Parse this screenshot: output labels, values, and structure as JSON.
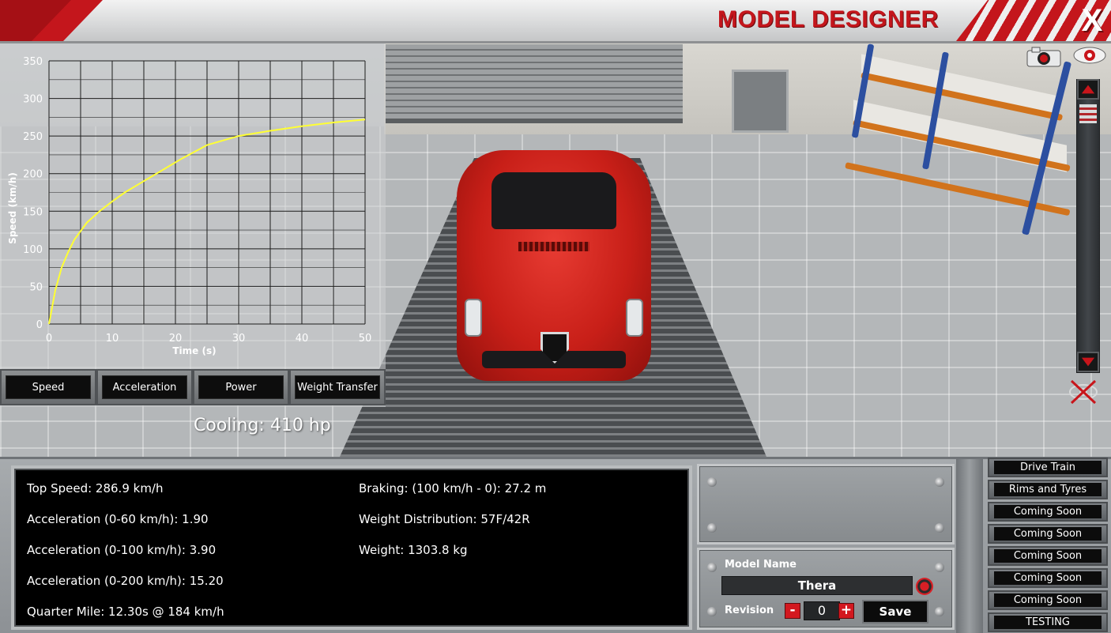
{
  "window": {
    "title": "MODEL DESIGNER",
    "close_label": "X"
  },
  "chart_data": {
    "type": "line",
    "title": "",
    "xlabel": "Time (s)",
    "ylabel": "Speed (km/h)",
    "xlim": [
      0,
      50
    ],
    "ylim": [
      0,
      350
    ],
    "x_ticks": [
      0,
      10,
      20,
      30,
      40,
      50
    ],
    "y_ticks": [
      0,
      50,
      100,
      150,
      200,
      250,
      300,
      350
    ],
    "grid": true,
    "line_color": "#ffff33",
    "series": [
      {
        "x": [
          0,
          1,
          2,
          3,
          4,
          6,
          8,
          10,
          12,
          15,
          18,
          21,
          25,
          30,
          35,
          40,
          45,
          50
        ],
        "y": [
          0,
          45,
          75,
          95,
          112,
          135,
          150,
          163,
          175,
          190,
          205,
          220,
          238,
          250,
          257,
          263,
          268,
          272
        ]
      }
    ]
  },
  "graph_tabs": [
    "Speed",
    "Acceleration",
    "Power",
    "Weight Transfer"
  ],
  "cooling": "Cooling: 410 hp",
  "stats": {
    "top_speed": "Top Speed: 286.9 km/h",
    "accel_60": "Acceleration (0-60 km/h): 1.90",
    "accel_100": "Acceleration (0-100 km/h): 3.90",
    "accel_200": "Acceleration (0-200 km/h): 15.20",
    "quarter_mile": "Quarter Mile: 12.30s @ 184 km/h",
    "braking": "Braking: (100 km/h - 0): 27.2 m",
    "weight_distribution": "Weight Distribution: 57F/42R",
    "weight": "Weight: 1303.8 kg"
  },
  "model": {
    "name_label": "Model Name",
    "name_value": "Thera",
    "revision_label": "Revision",
    "revision_value": "0",
    "minus_label": "-",
    "plus_label": "+",
    "save_label": "Save"
  },
  "side_menu": [
    "Drive Train",
    "Rims and Tyres",
    "Coming Soon",
    "Coming Soon",
    "Coming Soon",
    "Coming Soon",
    "Coming Soon",
    "TESTING"
  ],
  "icons": {
    "camera": "camera-icon",
    "eye": "eye-icon",
    "hide": "eye-off-icon",
    "scroll_up": "chevron-up-icon",
    "scroll_down": "chevron-down-icon"
  },
  "colors": {
    "accent_red": "#c4161c",
    "car_red": "#d12a22"
  }
}
